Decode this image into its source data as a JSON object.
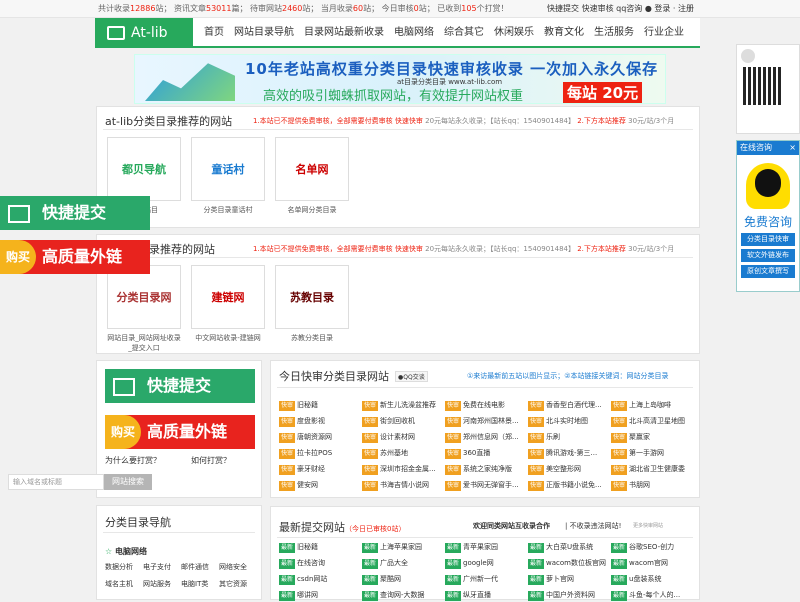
{
  "topbar": {
    "stats": [
      {
        "label": "共计收录",
        "value": "12886",
        "unit": "站"
      },
      {
        "label": "资讯文章",
        "value": "53011",
        "unit": "篇"
      },
      {
        "label": "待审网站",
        "value": "2460",
        "unit": "站"
      },
      {
        "label": "当月收录",
        "value": "60",
        "unit": "站"
      },
      {
        "label": "今日审核",
        "value": "0",
        "unit": "站"
      },
      {
        "label": "已收到",
        "value": "105",
        "unit": "个打赏！"
      }
    ],
    "links": [
      "快捷提交",
      "快速审核",
      "qq咨询",
      "登录",
      "注册"
    ]
  },
  "nav": {
    "logo": "At-lib",
    "items": [
      "首页",
      "网站目录导航",
      "目录网站最新收录",
      "电脑网络",
      "综合其它",
      "休闲娱乐",
      "教育文化",
      "生活服务",
      "行业企业"
    ]
  },
  "banner": {
    "line1": "10年老站高权重分类目录快速审核收录 一次加入永久保存",
    "line2": "at目录分类目录  www.at-lib.com",
    "line3": "高效的吸引蜘蛛抓取网站，有效提升网站权重",
    "line4": "每站 20元"
  },
  "section1": {
    "title": "at-lib分类目录推荐的网站",
    "note_red": "1.本站已不提供免费审核，全部需要付费审核 快速快审",
    "note_grey": "20元每站永久收录；【站长qq：1540901484】",
    "note_red2": "2.下方本站推荐",
    "note_grey2": "30元/站/3个月",
    "cards": [
      {
        "caption": "录网站目",
        "logo": "都贝导航"
      },
      {
        "caption": "分类目录童话村",
        "logo": "童话村"
      },
      {
        "caption": "名单网分类目录",
        "logo": "名单网"
      }
    ]
  },
  "section2": {
    "title": "录推荐的网站",
    "note_red": "1.本站已不提供免费审核，全部需要付费审核 快速快审",
    "note_grey": "20元每站永久收录；【站长qq：1540901484】",
    "note_red2": "2.下方本站推荐",
    "note_grey2": "30元/站/3个月",
    "cards": [
      {
        "caption": "网站目录_网站网址收录_提交入口",
        "logo": "分类目录网"
      },
      {
        "caption": "中文网站收录-建链网",
        "logo": "建链网"
      },
      {
        "caption": "苏教分类目录",
        "logo": "苏教目录"
      }
    ]
  },
  "float": {
    "quick": "快捷提交",
    "buy": "购买",
    "high": "高质量外链"
  },
  "leftbox": {
    "quick": "快捷提交",
    "buy": "购买",
    "high": "高质量外链",
    "why": "为什么要打赏？",
    "how": "如何打赏？",
    "placeholder": "输入域名或标题",
    "search": "网站搜索"
  },
  "catnav": {
    "title": "分类目录导航",
    "cat": "电脑网络",
    "items": [
      "数据分析",
      "电子支付",
      "邮件通信",
      "网络安全",
      "域名主机",
      "网站服务",
      "电脑IT类",
      "其它资源"
    ]
  },
  "today": {
    "title": "今日快审分类目录网站",
    "badge": "QQ交谈",
    "tip": "①来访最新前五站以图片显示；②本站链接关键词：网站分类目录",
    "tag": "快审",
    "items": [
      "旧秘籍",
      "新生儿洗澡盆推荐",
      "免费在线电影",
      "香香型白酒代理...",
      "上海上岛咖啡",
      "度盘影视",
      "街剑回收机",
      "河南郑州国林景...",
      "北斗实时地图",
      "北斗高清卫星地图",
      "唐朝资源网",
      "设计素材网",
      "郑州信息网（郑...",
      "乐刷",
      "聚赢家",
      "拉卡拉POS",
      "苏州基地",
      "360直播",
      "腾讯游戏-第三...",
      "第一手游网",
      "豪牙财经",
      "深圳市招金金属...",
      "系统之家纯净版",
      "美空整形网",
      "湖北省卫生健康委",
      "健安网",
      "书海吉情小说网",
      "爱书网无弹窗手...",
      "正版书籍小说免...",
      "书朋网"
    ]
  },
  "latest": {
    "title": "最新提交网站",
    "sub": "（今日已审核0站）",
    "welcome": "欢迎同类网站互收录合作",
    "rule": "| 不收录违法网站!",
    "more": "更多快审网站",
    "tag": "最新",
    "items": [
      "旧秘籍",
      "上海苹果家园",
      "青苹果家园",
      "大白菜U盘系统",
      "谷歌SEO-创力",
      "在线咨询",
      "广品大全",
      "google网",
      "wacom数位板官网",
      "wacom官网",
      "csdn网站",
      "聚酷网",
      "广州新一代",
      "萝卜官网",
      "u盘装系统",
      "哪讲网",
      "查询网-大数据",
      "纵牙直播",
      "中国户外资料网",
      "斗鱼-每个人的..."
    ]
  },
  "right": {
    "online": "在线咨询",
    "free": "免费咨询",
    "buttons": [
      "分类目录快审",
      "软文外链发布",
      "原创文章撰写"
    ]
  }
}
